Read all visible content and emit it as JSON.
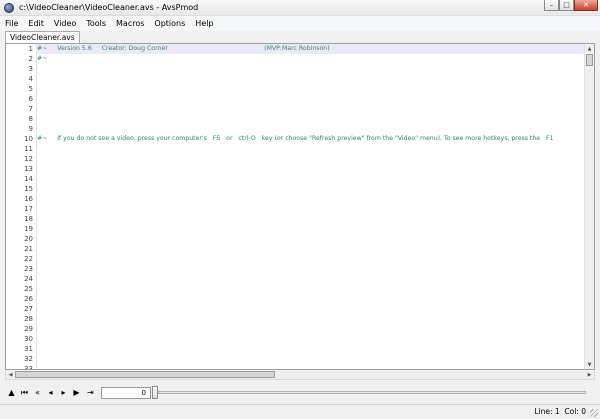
{
  "window": {
    "title": "c:\\VideoCleaner\\VideoCleaner.avs - AvsPmod",
    "buttons": {
      "minimize": "–",
      "maximize": "□",
      "close": "✕"
    }
  },
  "menu": [
    "File",
    "Edit",
    "Video",
    "Tools",
    "Macros",
    "Options",
    "Help"
  ],
  "tabs": [
    {
      "label": "VideoCleaner.avs"
    }
  ],
  "editor": {
    "line_numbers": [
      "1",
      "2",
      "3",
      "4",
      "5",
      "6",
      "7",
      "8",
      "9",
      "10",
      "11",
      "12",
      "13",
      "14",
      "15",
      "16",
      "17",
      "18",
      "19",
      "20",
      "21",
      "22",
      "23",
      "24",
      "25",
      "26",
      "27",
      "28",
      "29",
      "30",
      "31",
      "32",
      "33"
    ],
    "lines": [
      "#~     Version 5.6     Creator: Doug Corner                                                 (MVP:Marc Robinson)",
      "#~",
      "",
      "",
      "",
      "",
      "",
      "",
      "",
      "#~     If you do not see a video, press your computer's   F5   or   ctrl-O   key (or choose \"Refresh preview\" from the \"Video\" menu). To see more hotkeys, press the   F1"
    ]
  },
  "playback": {
    "frame_value": "0"
  },
  "status": {
    "line": "Line: 1",
    "col": "Col: 0"
  },
  "colors": {
    "comment": "#2e8b57",
    "current_line": "#ebe9fa"
  }
}
